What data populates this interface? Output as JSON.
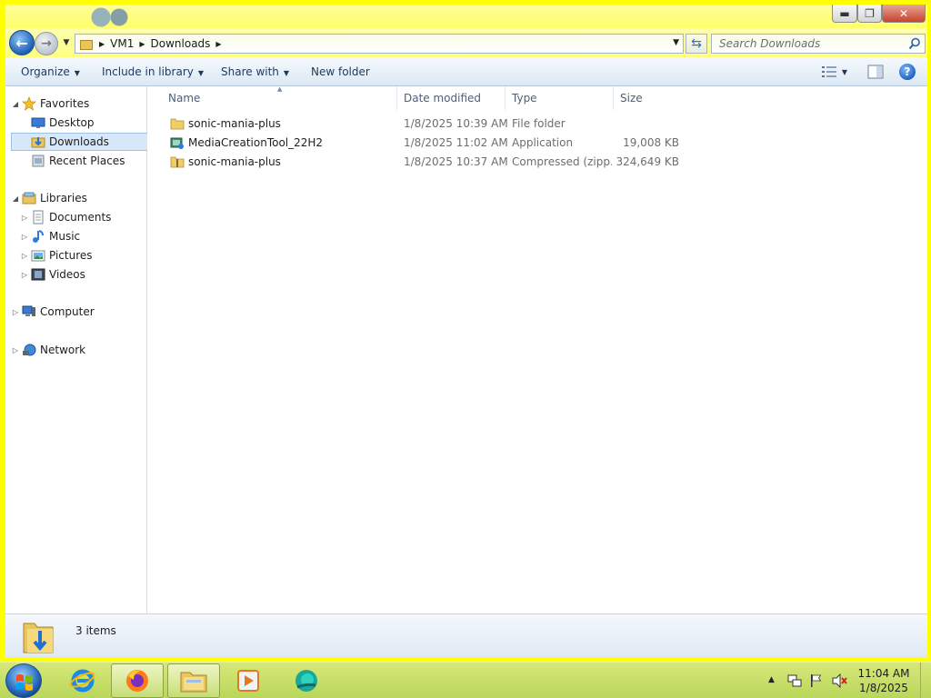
{
  "window": {
    "controls": {
      "minimize": "▬",
      "maximize": "❐",
      "close": "✕"
    }
  },
  "nav": {
    "back": "←",
    "forward": "→",
    "breadcrumb": [
      "VM1",
      "Downloads"
    ],
    "search_placeholder": "Search Downloads"
  },
  "toolbar": {
    "organize": "Organize",
    "include_in_library": "Include in library",
    "share_with": "Share with",
    "new_folder": "New folder",
    "help": "?"
  },
  "sidebar": {
    "favorites": {
      "label": "Favorites",
      "items": [
        {
          "label": "Desktop",
          "icon": "desktop-icon"
        },
        {
          "label": "Downloads",
          "icon": "downloads-folder-icon",
          "selected": true
        },
        {
          "label": "Recent Places",
          "icon": "recent-places-icon"
        }
      ]
    },
    "libraries": {
      "label": "Libraries",
      "items": [
        {
          "label": "Documents",
          "icon": "documents-icon"
        },
        {
          "label": "Music",
          "icon": "music-icon"
        },
        {
          "label": "Pictures",
          "icon": "pictures-icon"
        },
        {
          "label": "Videos",
          "icon": "videos-icon"
        }
      ]
    },
    "computer": {
      "label": "Computer"
    },
    "network": {
      "label": "Network"
    }
  },
  "filelist": {
    "columns": [
      "Name",
      "Date modified",
      "Type",
      "Size"
    ],
    "rows": [
      {
        "name": "sonic-mania-plus",
        "date": "1/8/2025 10:39 AM",
        "type": "File folder",
        "size": "",
        "icon": "folder-icon"
      },
      {
        "name": "MediaCreationTool_22H2",
        "date": "1/8/2025 11:02 AM",
        "type": "Application",
        "size": "19,008 KB",
        "icon": "application-icon"
      },
      {
        "name": "sonic-mania-plus",
        "date": "1/8/2025 10:37 AM",
        "type": "Compressed (zipp...",
        "size": "324,649 KB",
        "icon": "zip-folder-icon"
      }
    ]
  },
  "status": {
    "items_text": "3 items"
  },
  "taskbar": {
    "clock_time": "11:04 AM",
    "clock_date": "1/8/2025"
  },
  "colors": {
    "window_frame": "#ffff00",
    "taskbar": "#c8df6a",
    "selection": "#d9e8f8"
  }
}
